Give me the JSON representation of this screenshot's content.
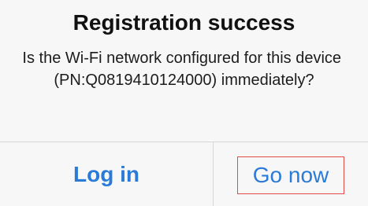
{
  "dialog": {
    "title": "Registration success",
    "message": "Is the Wi-Fi network configured for this device  (PN:Q0819410124000) immediately?",
    "buttons": {
      "login_label": "Log in",
      "gonow_label": "Go now"
    }
  },
  "colors": {
    "button_text": "#2a7ad8",
    "highlight_border": "#e34a4a",
    "background": "#f7f7f7"
  }
}
